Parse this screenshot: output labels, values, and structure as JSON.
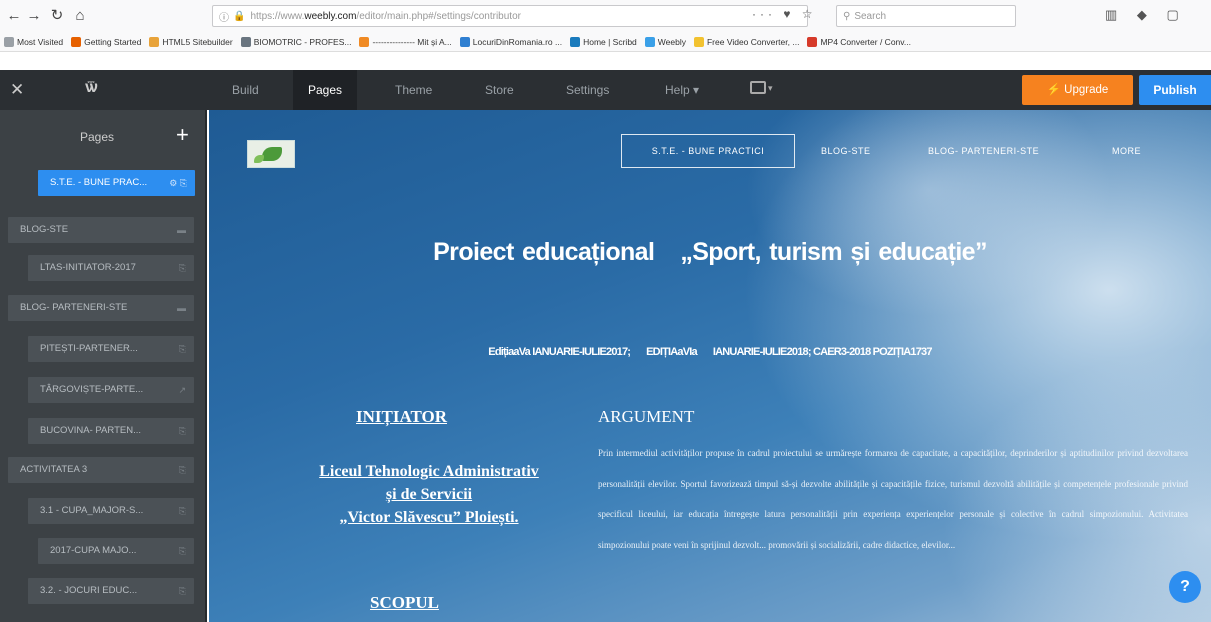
{
  "browser": {
    "url_prefix": "https://www.",
    "url_domain": "weebly.com",
    "url_path": "/editor/main.php#/settings/contributor",
    "search_placeholder": "Search",
    "bookmarks": [
      {
        "label": "Most Visited",
        "color": "#9aa0a6"
      },
      {
        "label": "Getting Started",
        "color": "#e66000"
      },
      {
        "label": "HTML5 Sitebuilder",
        "color": "#e8a33a"
      },
      {
        "label": "BIOMOTRIC - PROFES...",
        "color": "#6a7580"
      },
      {
        "label": "--------------- Mit și A...",
        "color": "#f08a24"
      },
      {
        "label": "LocuriDinRomania.ro ...",
        "color": "#2f7fd1"
      },
      {
        "label": "Home | Scribd",
        "color": "#1a7bbd"
      },
      {
        "label": "Weebly",
        "color": "#3aa0e8"
      },
      {
        "label": "Free Video Converter, ...",
        "color": "#f2c230"
      },
      {
        "label": "MP4 Converter / Conv...",
        "color": "#d63a2a"
      }
    ]
  },
  "toolbar": {
    "tabs": [
      "Build",
      "Pages",
      "Theme",
      "Store",
      "Settings",
      "Help"
    ],
    "help_caret": "▾",
    "upgrade_label": "⚡ Upgrade",
    "publish_label": "Publish"
  },
  "sidebar": {
    "title": "Pages",
    "add_symbol": "+",
    "pages": [
      {
        "label": "S.T.E. - BUNE PRAC...",
        "selected": true
      },
      {
        "label": "BLOG-STE",
        "selected": false
      },
      {
        "label": "LTAS-INITIATOR-2017",
        "selected": false
      },
      {
        "label": "BLOG- PARTENERI-STE",
        "selected": false
      },
      {
        "label": "PITEȘTI-PARTENER...",
        "selected": false
      },
      {
        "label": "TÂRGOVIȘTE-PARTE...",
        "selected": false
      },
      {
        "label": "BUCOVINA- PARTEN...",
        "selected": false
      },
      {
        "label": "ACTIVITATEA 3",
        "selected": false
      },
      {
        "label": "3.1 - CUPA_MAJOR-S...",
        "selected": false
      },
      {
        "label": "2017-CUPA MAJO...",
        "selected": false
      },
      {
        "label": "3.2. - JOCURI EDUC...",
        "selected": false
      }
    ]
  },
  "site": {
    "nav": [
      "S.T.E. - BUNE PRACTICI",
      "BLOG-STE",
      "BLOG- PARTENERI-STE",
      "MORE"
    ],
    "title_a": "Proiect educațional",
    "title_b": "„Sport, turism și educație”",
    "edition_a": "EdițiaaVa IANUARIE-IULIE2017;",
    "edition_b": "EDIȚIAaVIa",
    "edition_c": "IANUARIE-IULIE2018; CAER3-2018 POZIȚIA1737",
    "initiator_head": "INIȚIATOR",
    "initiator_lines": [
      "Liceul Tehnologic Administrativ",
      "și de Servicii",
      "„Victor Slăvescu” Ploiești."
    ],
    "scope_head": "SCOPUL",
    "argument_head": "ARGUMENT",
    "argument_text": "Prin intermediul activităților propuse în cadrul proiectului se urmărește formarea de capacitate, a capacităților, deprinderilor și aptitudinilor privind dezvoltarea personalității elevilor. Sportul favorizează timpul să-și dezvolte abilitățile și capacitățile fizice, turismul dezvoltă abilitățile și competențele profesionale privind specificul liceului, iar educația întregește latura personalității prin experiența experiențelor personale și colective în cadrul simpozionului. Activitatea simpozionului poate veni în sprijinul dezvolt... promovării și socializării, cadre didactice, elevilor..."
  }
}
